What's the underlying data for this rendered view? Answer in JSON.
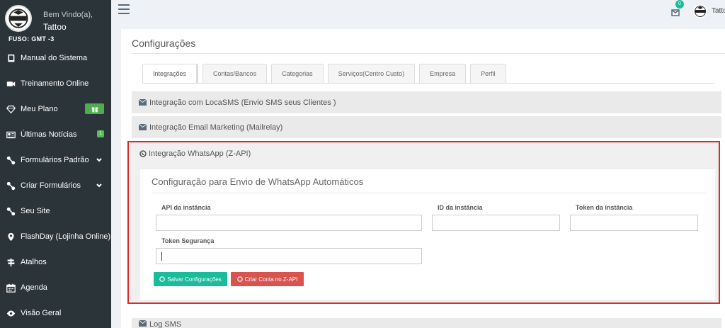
{
  "sidebar": {
    "welcome": "Bem Vindo(a),",
    "user": "Tattoo",
    "timezone": "FUSO: GMT -3",
    "items": [
      {
        "label": "Manual do Sistema",
        "icon": "book-icon"
      },
      {
        "label": "Treinamento Online",
        "icon": "video-camera-icon"
      },
      {
        "label": "Meu Plano",
        "icon": "diamond-icon",
        "badge": "gift-icon"
      },
      {
        "label": "Últimas Notícias",
        "icon": "newspaper-icon",
        "badge_text": "1"
      },
      {
        "label": "Formulários Padrão",
        "icon": "link-icon",
        "chevron": true
      },
      {
        "label": "Criar Formulários",
        "icon": "link-icon",
        "chevron": true
      },
      {
        "label": "Seu Site",
        "icon": "link-icon"
      },
      {
        "label": "FlashDay (Lojinha Online)",
        "icon": "map-marker-icon"
      },
      {
        "label": "Atalhos",
        "icon": "signpost-icon"
      },
      {
        "label": "Agenda",
        "icon": "calendar-icon"
      },
      {
        "label": "Visão Geral",
        "icon": "eye-icon"
      }
    ]
  },
  "topbar": {
    "mail_count": "0",
    "user": "Tattoo"
  },
  "page": {
    "title": "Configurações",
    "tabs": [
      "Integrações",
      "Contas/Bancos",
      "Categorias",
      "Serviços(Centro Custo)",
      "Empresa",
      "Perfil"
    ],
    "active_tab": 0
  },
  "sections": {
    "locasms": "Integração com LocaSMS (Envio SMS seus Clientes )",
    "mailrelay": "Integração Email Marketing (Mailrelay)",
    "whatsapp": "Integração WhatsApp (Z-API)",
    "log_sms": "Log SMS"
  },
  "whatsapp_form": {
    "title": "Configuração para Envio de WhatsApp Automáticos",
    "api_label": "API da instância",
    "api_value": "",
    "id_label": "ID da instância",
    "id_value": "",
    "token_label": "Token da instância",
    "token_value": "",
    "security_label": "Token Segurança",
    "security_value": "",
    "save_button": "Salvar Configurações",
    "create_button": "Criar Conta no Z-API"
  },
  "colors": {
    "sidebar_bg": "#2b3539",
    "accent_green": "#1abc9c",
    "danger_red": "#d9534f",
    "highlight_border": "#d82c2c"
  }
}
